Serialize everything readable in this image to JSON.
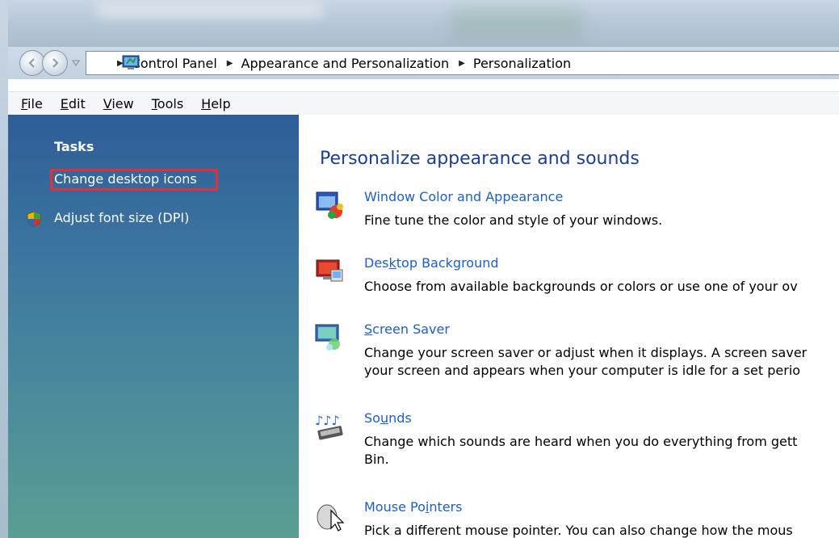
{
  "address_bar": {
    "crumbs": [
      "Control Panel",
      "Appearance and Personalization",
      "Personalization"
    ]
  },
  "menu": {
    "items": [
      {
        "label": "File"
      },
      {
        "label": "Edit"
      },
      {
        "label": "View"
      },
      {
        "label": "Tools"
      },
      {
        "label": "Help"
      }
    ]
  },
  "sidebar": {
    "heading": "Tasks",
    "links": [
      {
        "label": "Change desktop icons"
      },
      {
        "label": "Adjust font size (DPI)"
      }
    ]
  },
  "main": {
    "title": "Personalize appearance and sounds",
    "tasks": [
      {
        "label": "Window Color and Appearance",
        "description": "Fine tune the color and style of your windows."
      },
      {
        "label": "Desktop Background",
        "description": "Choose from available backgrounds or colors or use one of your ov"
      },
      {
        "label": "Screen Saver",
        "description": "Change your screen saver or adjust when it displays. A screen saver",
        "description2": "your screen and appears when your computer is idle for a set perio"
      },
      {
        "label": "Sounds",
        "description": "Change which sounds are heard when you do everything from gett",
        "description2": "Bin."
      },
      {
        "label": "Mouse Pointers",
        "description": "Pick a different mouse pointer. You can also change how the mous"
      }
    ]
  },
  "colors": {
    "sidebar_top": "#2e5d97",
    "sidebar_bottom": "#5a9e93",
    "link_blue": "#1f5fbf",
    "title_blue": "#1e3f8c",
    "highlight_red": "#e0303a"
  }
}
